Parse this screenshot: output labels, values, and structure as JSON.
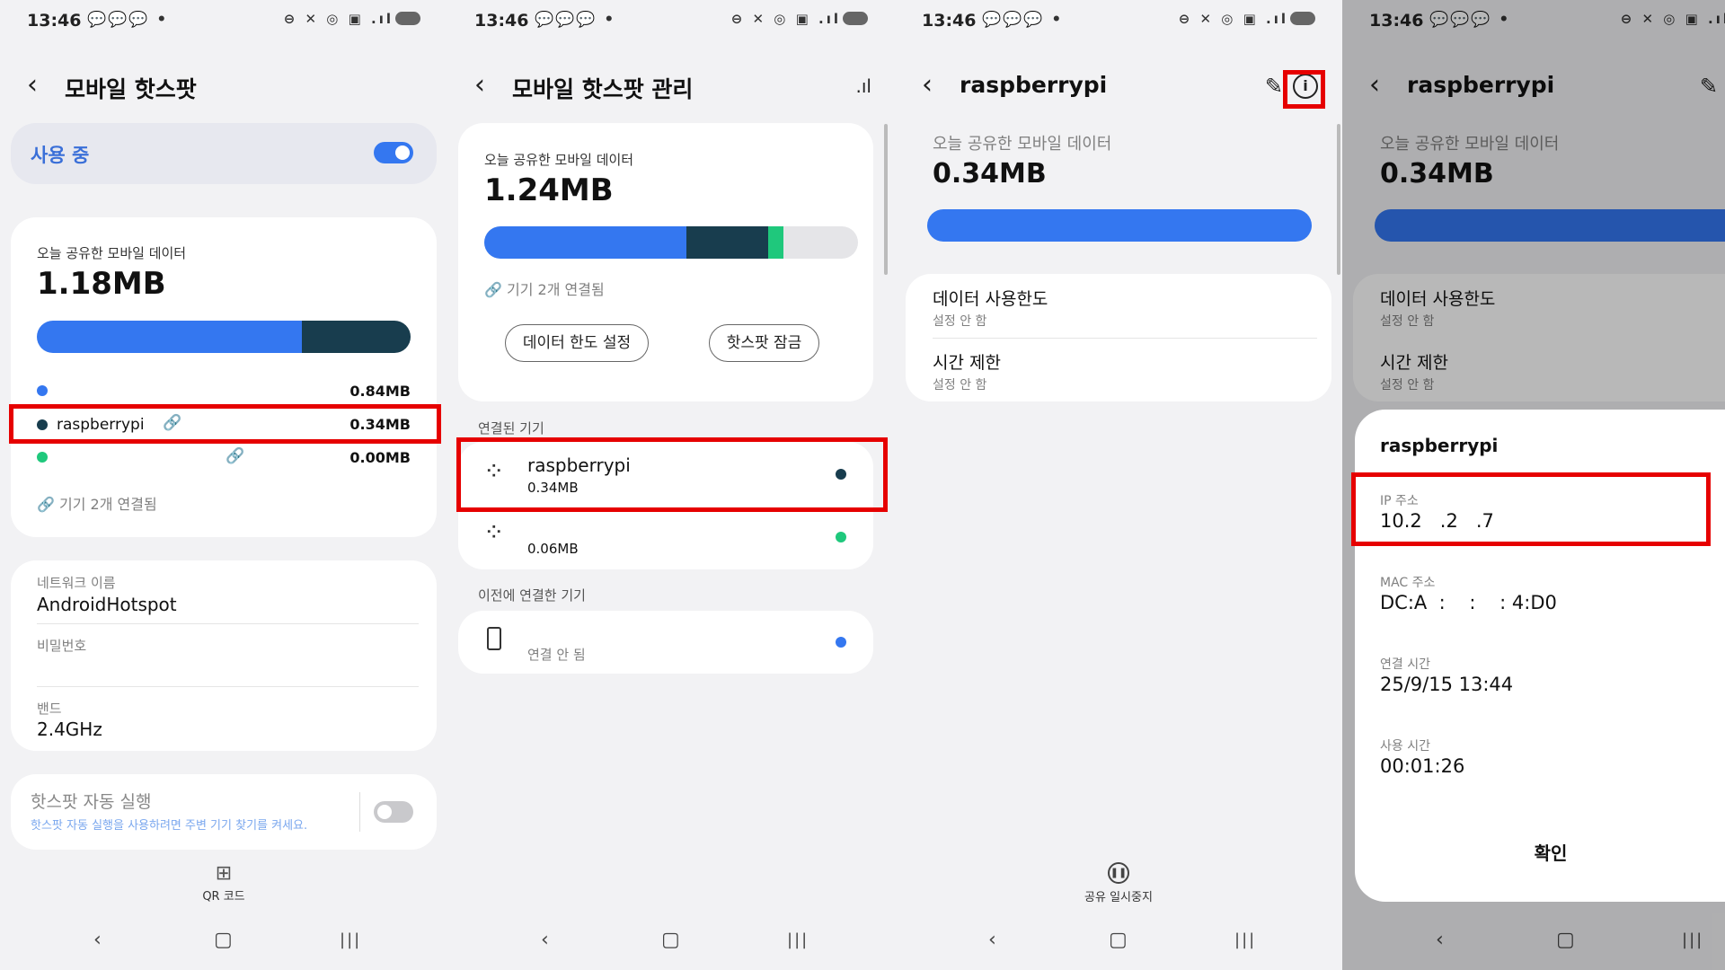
{
  "status": {
    "time": "13:46",
    "notif_icons": "💬💬💬 •",
    "sys_icons": "⊖ ✕ ◎ ▣ .ıl"
  },
  "colors": {
    "blue": "#3477f0",
    "dark": "#183d4e",
    "green": "#1fc87c",
    "highlight": "#e60000"
  },
  "screen1": {
    "title": "모바일 핫스팟",
    "in_use_label": "사용 중",
    "in_use_on": true,
    "today_label": "오늘 공유한 모바일 데이터",
    "today_value": "1.18MB",
    "usage_fractions": {
      "blue": 0.71,
      "dark": 0.29
    },
    "rows": [
      {
        "name": "",
        "value": "0.84MB"
      },
      {
        "name": "raspberrypi",
        "value": "0.34MB"
      },
      {
        "name": "",
        "value": "0.00MB"
      }
    ],
    "devices_connected": "기기 2개 연결됨",
    "network_name_label": "네트워크 이름",
    "network_name": "AndroidHotspot",
    "password_label": "비밀번호",
    "band_label": "밴드",
    "band": "2.4GHz",
    "auto_title": "핫스팟 자동 실행",
    "auto_desc": "핫스팟 자동 실행을 사용하려면 주변 기기 찾기를 켜세요.",
    "auto_on": false,
    "qr_label": "QR 코드"
  },
  "screen2": {
    "title": "모바일 핫스팟 관리",
    "today_label": "오늘 공유한 모바일 데이터",
    "today_value": "1.24MB",
    "usage_fractions": {
      "blue": 0.54,
      "dark": 0.22,
      "green": 0.04
    },
    "devices_connected": "기기 2개 연결됨",
    "limit_btn": "데이터 한도 설정",
    "lock_btn": "핫스팟 잠금",
    "connected_header": "연결된 기기",
    "connected": [
      {
        "name": "raspberrypi",
        "usage": "0.34MB"
      },
      {
        "name": "",
        "usage": "0.06MB"
      }
    ],
    "previous_header": "이전에 연결한 기기",
    "previous": [
      {
        "status": "연결 안 됨"
      }
    ]
  },
  "screen3": {
    "title": "raspberrypi",
    "today_label": "오늘 공유한 모바일 데이터",
    "today_value": "0.34MB",
    "limit_title": "데이터 사용한도",
    "limit_value": "설정 안 함",
    "time_title": "시간 제한",
    "time_value": "설정 안 함",
    "pause_label": "공유 일시중지"
  },
  "screen4": {
    "title": "raspberrypi",
    "today_label": "오늘 공유한 모바일 데이터",
    "today_value": "0.34MB",
    "limit_title": "데이터 사용한도",
    "limit_value": "설정 안 함",
    "time_title": "시간 제한",
    "time_value": "설정 안 함",
    "dialog": {
      "title": "raspberrypi",
      "ip_label": "IP 주소",
      "ip_value": "10.2   .2   .7",
      "mac_label": "MAC 주소",
      "mac_value": "DC:A  :    :    : 4:D0",
      "conn_time_label": "연결 시간",
      "conn_time_value": "25/9/15 13:44",
      "use_time_label": "사용 시간",
      "use_time_value": "00:01:26",
      "ok": "확인"
    }
  }
}
